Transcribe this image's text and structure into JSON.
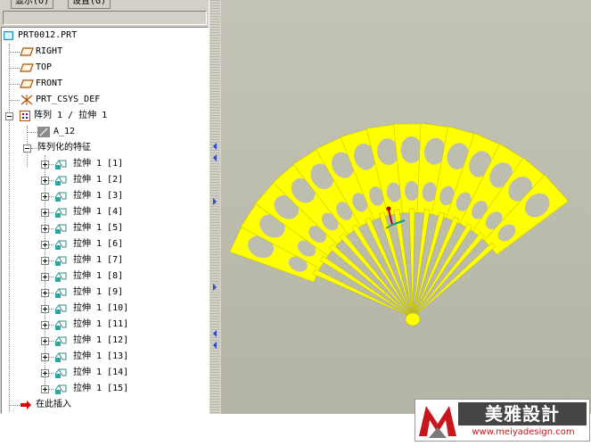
{
  "menu": {
    "display": "显示(O)",
    "settings": "设置(G)"
  },
  "model_tree": {
    "root": "PRT0012.PRT",
    "datums": [
      "RIGHT",
      "TOP",
      "FRONT"
    ],
    "csys": "PRT_CSYS_DEF",
    "pattern": "阵列 1 / 拉伸 1",
    "dimension": "A_12",
    "patterned_features": "阵列化的特征",
    "members": [
      "拉伸 1 [1]",
      "拉伸 1 [2]",
      "拉伸 1 [3]",
      "拉伸 1 [4]",
      "拉伸 1 [5]",
      "拉伸 1 [6]",
      "拉伸 1 [7]",
      "拉伸 1 [8]",
      "拉伸 1 [9]",
      "拉伸 1 [10]",
      "拉伸 1 [11]",
      "拉伸 1 [12]",
      "拉伸 1 [13]",
      "拉伸 1 [14]",
      "拉伸 1 [15]"
    ],
    "insert_here": "在此插入"
  },
  "watermark": {
    "brand": "美雅設計",
    "url": "www.meiyadesign.com"
  },
  "colors": {
    "fan": "#ffff00",
    "viewport_bg": "#bebeb0",
    "tree_bg": "#ffffff",
    "insert_arrow": "#e00000"
  },
  "icons": {
    "root": "part-icon",
    "datum": "datum-plane-icon",
    "csys": "coordinate-system-icon",
    "pattern": "pattern-icon",
    "dimension": "dimension-icon",
    "extrude": "extrude-icon",
    "insert": "insert-arrow-icon"
  }
}
